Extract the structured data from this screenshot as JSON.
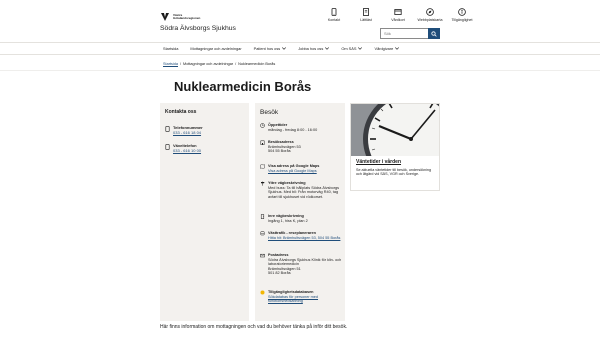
{
  "header": {
    "logo_text": "Västra Götalandsregionen",
    "site_name": "Södra Älvsborgs Sjukhus",
    "top_links": [
      {
        "label": "Kontakt",
        "icon": "phone-icon"
      },
      {
        "label": "Lättläst",
        "icon": "book-icon"
      },
      {
        "label": "Vårdkort",
        "icon": "card-icon"
      },
      {
        "label": "Webbplatskarta",
        "icon": "compass-icon"
      },
      {
        "label": "Tillgänglighet",
        "icon": "accessibility-icon"
      }
    ],
    "search_placeholder": "Sök"
  },
  "nav": {
    "items": [
      {
        "label": "Startsida",
        "has_chevron": false
      },
      {
        "label": "Mottagningar och avdelningar",
        "has_chevron": false
      },
      {
        "label": "Patient hos oss",
        "has_chevron": true
      },
      {
        "label": "Jobba hos oss",
        "has_chevron": true
      },
      {
        "label": "Om SÄS",
        "has_chevron": true
      },
      {
        "label": "Vårdgivare",
        "has_chevron": true
      }
    ]
  },
  "breadcrumb": {
    "items": [
      "Startsida",
      "Mottagningar och avdelningar",
      "Nuklearmedicin Borås"
    ],
    "separator": "/"
  },
  "page_title": "Nuklearmedicin Borås",
  "contact": {
    "heading": "Kontakta oss",
    "phone_label": "Telefonnummer",
    "phone_value": "033 - 616 18 04",
    "fax_label": "Växeltelefon",
    "fax_value": "033 - 616 10 00"
  },
  "visit": {
    "heading": "Besök",
    "hours_label": "Öppettider",
    "hours_value": "måndag - fredag 8:00 - 16:00",
    "address_label": "Besöksadress",
    "address_line1": "Brämhultsvägen 53",
    "address_line2": "504 55 Borås",
    "map_label": "Visa adress på Google Maps",
    "map_link": "Visa adress på Google Maps",
    "directions_label": "Yttre vägbeskrivning",
    "directions_text": "Med buss: Ta till hållplats Södra Älvsborgs Sjukhus. Med bil: Från motorväg R40, tag avfart till sjukhuset vid rödkorset.",
    "inner_label": "Inre vägbeskrivning",
    "inner_text": "Ingång 1, hiss K, plan 2",
    "transit_label": "Västtrafik - reseplaneraren",
    "transit_link": "Hitta hit: Brämhultsvägen 53, 504 55 Borås",
    "post_label": "Postadress",
    "post_line1": "Södra Älvsborgs Sjukhus Klinik för klin- och laboratoriemedicin",
    "post_line2": "Brämhultsvägen 51",
    "post_line3": "501 82 Borås",
    "access_label": "Tillgänglighetsdatabasen",
    "access_link": "Sökdatabas för personer med funktionsnedsättning"
  },
  "card": {
    "title": "Väntetider i vården",
    "text": "Se aktuella väntetider till besök, undersökning och åtgärd vid SÄS, VGR och Sverige."
  },
  "intro_text": "Här finns information om mottagningen och vad du behöver tänka på inför ditt besök.",
  "colors": {
    "accent": "#1f4d7a",
    "panel": "#f3f1ee",
    "sun": "#f2b705"
  }
}
